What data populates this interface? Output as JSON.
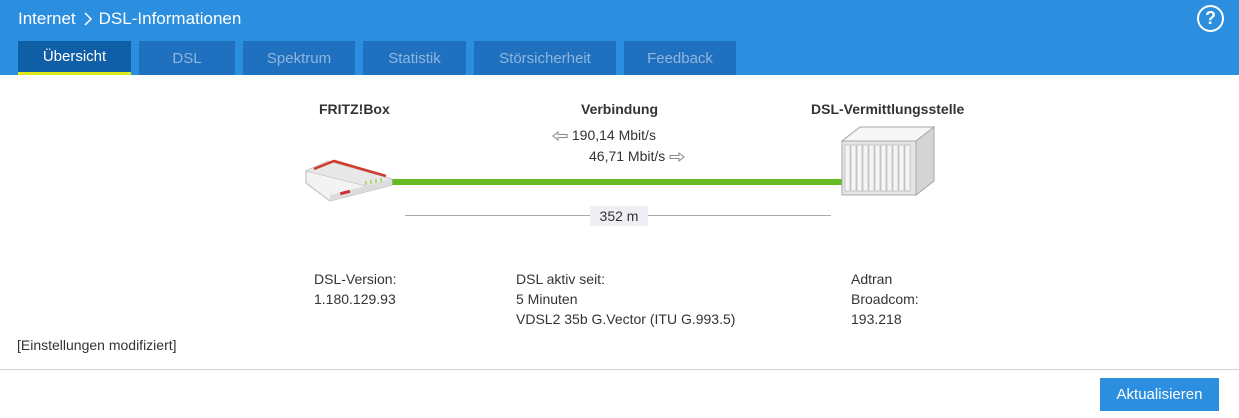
{
  "header": {
    "breadcrumb": [
      "Internet",
      "DSL-Informationen"
    ],
    "help_label": "?"
  },
  "tabs": [
    {
      "label": "Übersicht",
      "active": true
    },
    {
      "label": "DSL",
      "active": false
    },
    {
      "label": "Spektrum",
      "active": false
    },
    {
      "label": "Statistik",
      "active": false
    },
    {
      "label": "Störsicherheit",
      "active": false
    },
    {
      "label": "Feedback",
      "active": false
    }
  ],
  "overview": {
    "device_title": "FRITZ!Box",
    "connection_title": "Verbindung",
    "exchange_title": "DSL-Vermittlungsstelle",
    "downstream": "190,14 Mbit/s",
    "upstream": "46,71 Mbit/s",
    "distance": "352 m",
    "device_info": {
      "label": "DSL-Version:",
      "value": "1.180.129.93"
    },
    "connection_info": {
      "label": "DSL aktiv seit:",
      "duration": "5 Minuten",
      "mode": "VDSL2 35b G.Vector (ITU G.993.5)"
    },
    "exchange_info": {
      "vendor": "Adtran",
      "chip_label": "Broadcom:",
      "chip_version": "193.218"
    },
    "status_note": "[Einstellungen modifiziert]"
  },
  "footer": {
    "refresh_label": "Aktualisieren"
  },
  "colors": {
    "header": "#2b8ede",
    "tab": "#1f71bf",
    "tab_active": "#0f5fa6",
    "tab_underline": "#dfe91e",
    "line_ok": "#66bb22"
  },
  "icons": [
    "chevron-right-icon",
    "help-icon",
    "fritzbox-router-icon",
    "dslam-rack-icon",
    "arrow-left-icon",
    "arrow-right-icon"
  ]
}
